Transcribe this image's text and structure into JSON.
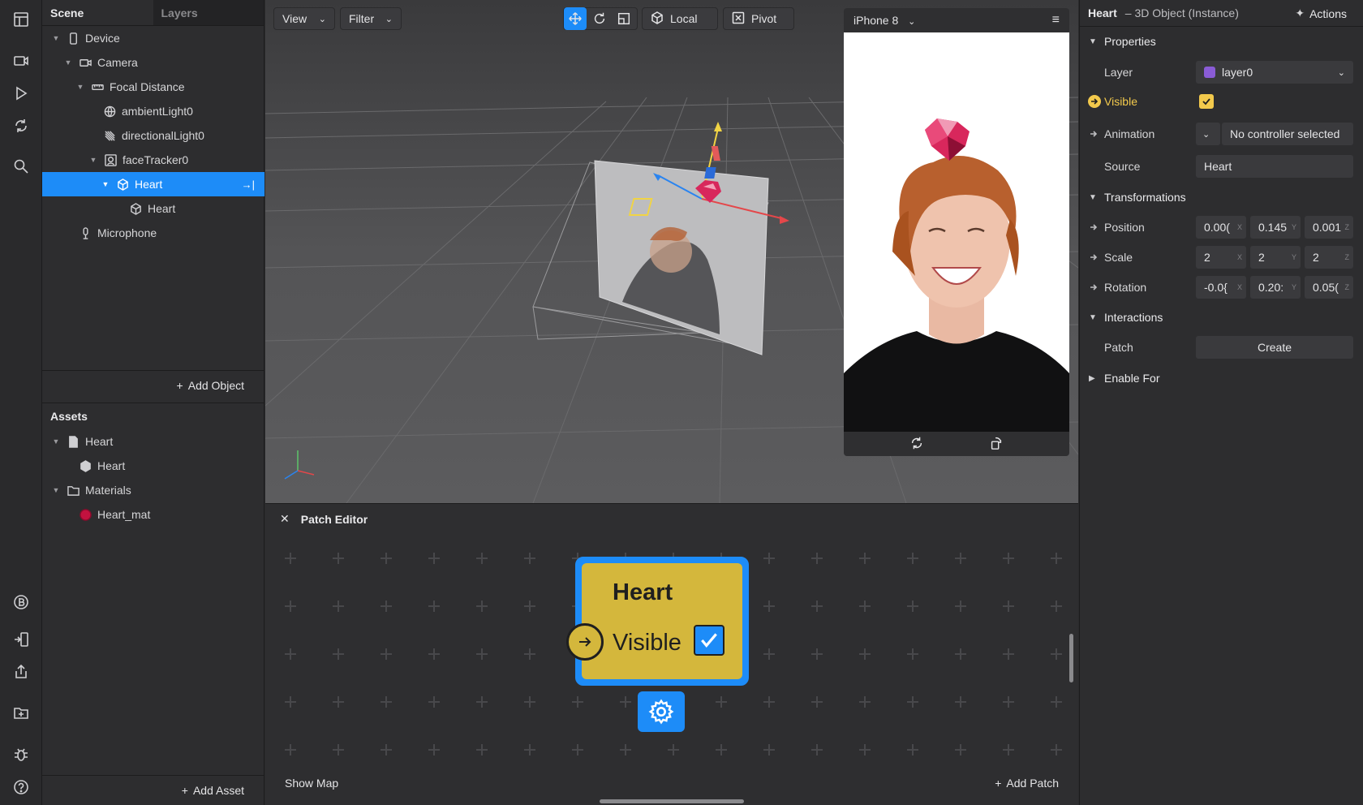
{
  "rail": {
    "icons": [
      "layout-icon",
      "video-icon",
      "play-icon",
      "sync-icon",
      "search-icon",
      "bitcoin-icon",
      "device-send-icon",
      "share-icon",
      "add-folder-icon",
      "bug-icon",
      "help-icon"
    ]
  },
  "scene": {
    "tab_scene": "Scene",
    "tab_layers": "Layers",
    "tree": [
      {
        "label": "Device",
        "icon": "phone-icon",
        "indent": 0
      },
      {
        "label": "Camera",
        "icon": "camera-icon",
        "indent": 1
      },
      {
        "label": "Focal Distance",
        "icon": "ruler-icon",
        "indent": 2
      },
      {
        "label": "ambientLight0",
        "icon": "globe-icon",
        "indent": 3
      },
      {
        "label": "directionalLight0",
        "icon": "directional-light-icon",
        "indent": 3
      },
      {
        "label": "faceTracker0",
        "icon": "face-tracker-icon",
        "indent": 3
      },
      {
        "label": "Heart",
        "icon": "cube-icon",
        "indent": 4,
        "selected": true
      },
      {
        "label": "Heart",
        "icon": "cube-icon",
        "indent": 5
      },
      {
        "label": "Microphone",
        "icon": "microphone-icon",
        "indent": 1
      }
    ],
    "add_object": "Add Object",
    "assets_title": "Assets",
    "assets": [
      {
        "label": "Heart",
        "icon": "file-icon"
      },
      {
        "label": "Heart",
        "icon": "cube-icon"
      },
      {
        "label": "Materials",
        "icon": "folder-icon"
      },
      {
        "label": "Heart_mat",
        "icon": "material-sphere-icon"
      }
    ],
    "add_asset": "Add Asset"
  },
  "viewport": {
    "view": "View",
    "filter": "Filter",
    "local": "Local",
    "pivot": "Pivot"
  },
  "preview": {
    "device": "iPhone 8"
  },
  "patch_editor": {
    "title": "Patch Editor",
    "node_title": "Heart",
    "node_port": "Visible",
    "node_checked": true,
    "show_map": "Show Map",
    "add_patch": "Add Patch"
  },
  "inspector": {
    "object_name": "Heart",
    "object_type": "– 3D Object (Instance)",
    "actions": "Actions",
    "properties": "Properties",
    "layer_label": "Layer",
    "layer_value": "layer0",
    "layer_color": "#8a5cd6",
    "visible_label": "Visible",
    "visible_checked": true,
    "animation_label": "Animation",
    "animation_value": "No controller selected",
    "source_label": "Source",
    "source_value": "Heart",
    "transformations": "Transformations",
    "position_label": "Position",
    "position": [
      "0.00(",
      "0.145",
      "0.001"
    ],
    "scale_label": "Scale",
    "scale": [
      "2",
      "2",
      "2"
    ],
    "rotation_label": "Rotation",
    "rotation": [
      "-0.0{",
      "0.20:",
      "0.05("
    ],
    "axes": [
      "X",
      "Y",
      "Z"
    ],
    "interactions": "Interactions",
    "patch_label": "Patch",
    "patch_button": "Create",
    "enable_for": "Enable For"
  },
  "colors": {
    "accent": "#1d8cf8",
    "patch_node": "#d4b73c",
    "visible_highlight": "#f2c94c"
  }
}
